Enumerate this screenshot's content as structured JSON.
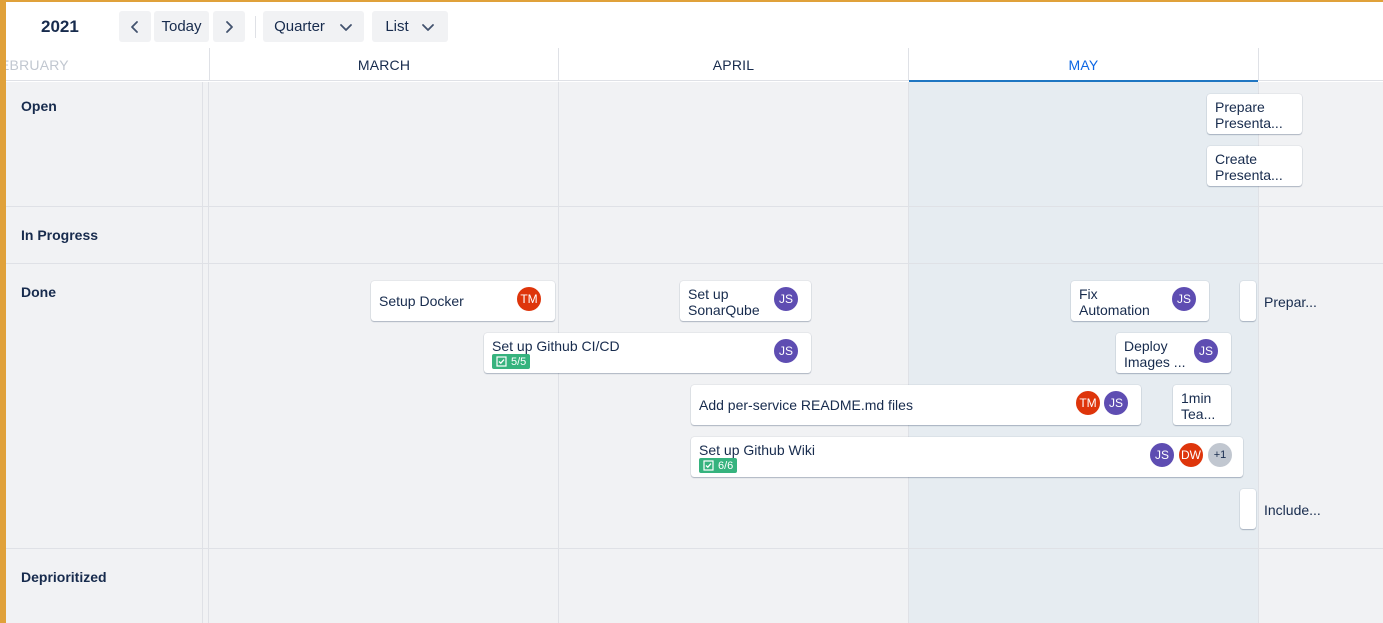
{
  "toolbar": {
    "year": "2021",
    "prev_icon": "chevron-left-icon",
    "today_label": "Today",
    "next_icon": "chevron-right-icon",
    "range_label": "Quarter",
    "view_label": "List"
  },
  "months": {
    "feb": "EBRUARY",
    "mar": "MARCH",
    "apr": "APRIL",
    "may": "MAY"
  },
  "lanes": {
    "open": "Open",
    "in_progress": "In Progress",
    "done": "Done",
    "deprioritized": "Deprioritized"
  },
  "cards": {
    "prepare_presentation": {
      "line1": "Prepare",
      "line2": "Presenta..."
    },
    "create_presentation": {
      "line1": "Create",
      "line2": "Presenta..."
    },
    "setup_docker": {
      "title": "Setup Docker",
      "avatar": "TM"
    },
    "sonarqube": {
      "line1": "Set up",
      "line2": "SonarQube",
      "avatar": "JS"
    },
    "fix_automation": {
      "line1": "Fix",
      "line2": "Automation",
      "avatar": "JS"
    },
    "github_cicd": {
      "title": "Set up Github CI/CD",
      "checklist": "5/5",
      "avatar": "JS"
    },
    "deploy_images": {
      "line1": "Deploy",
      "line2": "Images ...",
      "avatar": "JS"
    },
    "readme": {
      "title": "Add per-service README.md files",
      "avatar1": "TM",
      "avatar2": "JS"
    },
    "one_min": {
      "line1": "1min",
      "line2": "Tea..."
    },
    "github_wiki": {
      "title": "Set up Github Wiki",
      "checklist": "6/6",
      "avatar1": "JS",
      "avatar2": "DW",
      "more": "+1"
    },
    "prepar_stub": {
      "title": "Prepar..."
    },
    "include_stub": {
      "title": "Include..."
    }
  },
  "colors": {
    "accent": "#1f76c2",
    "frame": "#e0a13a",
    "avatar_js": "#5e4db2",
    "avatar_tm": "#de350b",
    "checklist_done": "#36b37e"
  }
}
